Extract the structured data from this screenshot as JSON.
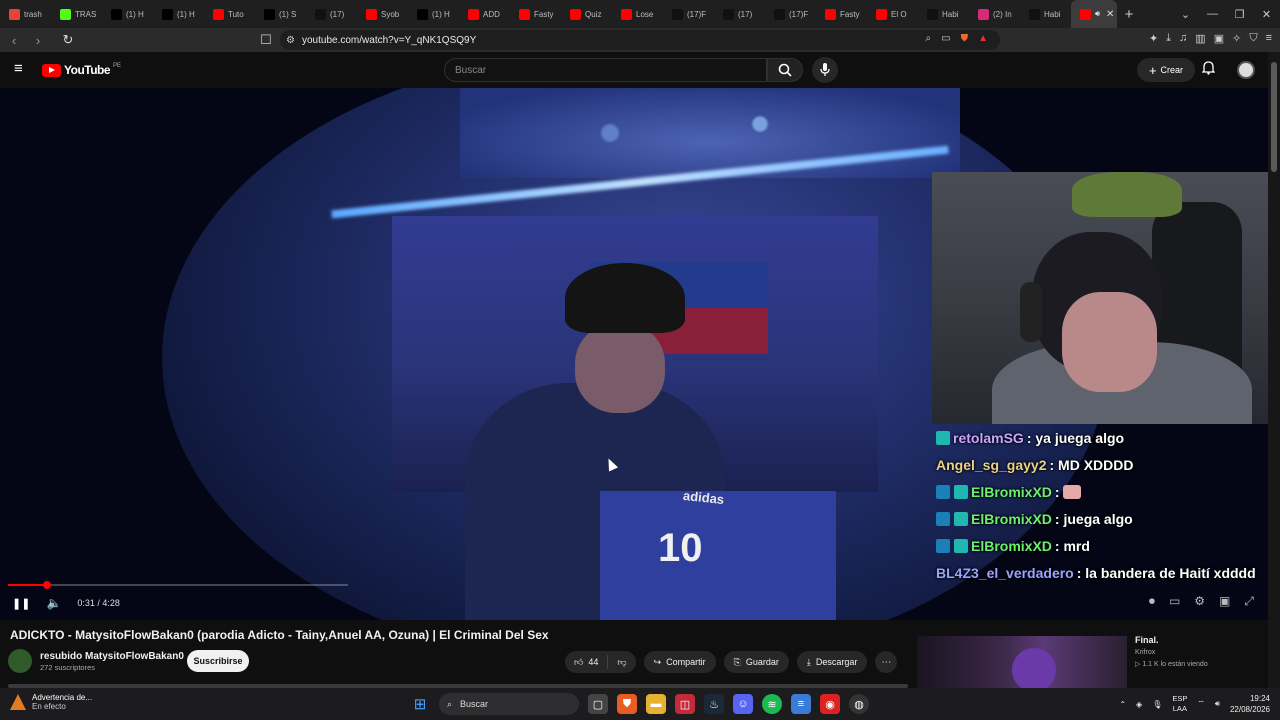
{
  "browser": {
    "tabs": [
      {
        "label": "trash",
        "icon": "gmail-icon",
        "color": "#ea4335"
      },
      {
        "label": "TRAS",
        "icon": "kick-icon",
        "color": "#53fc18"
      },
      {
        "label": "(1) H",
        "icon": "x-icon",
        "color": "#000000"
      },
      {
        "label": "(1) H",
        "icon": "x-icon",
        "color": "#000000"
      },
      {
        "label": "Tuto",
        "icon": "youtube-icon",
        "color": "#ff0000"
      },
      {
        "label": "(1) S",
        "icon": "x-icon",
        "color": "#000000"
      },
      {
        "label": "(17)",
        "icon": "tiktok-icon",
        "color": "#111111"
      },
      {
        "label": "Syob",
        "icon": "youtube-icon",
        "color": "#ff0000"
      },
      {
        "label": "(1) H",
        "icon": "x-icon",
        "color": "#000000"
      },
      {
        "label": "ADD",
        "icon": "youtube-icon",
        "color": "#ff0000"
      },
      {
        "label": "Fasty",
        "icon": "youtube-icon",
        "color": "#ff0000"
      },
      {
        "label": "Quiz",
        "icon": "youtube-icon",
        "color": "#ff0000"
      },
      {
        "label": "Lose",
        "icon": "youtube-icon",
        "color": "#ff0000"
      },
      {
        "label": "(17)F",
        "icon": "tiktok-icon",
        "color": "#111111"
      },
      {
        "label": "(17)",
        "icon": "tiktok-icon",
        "color": "#111111"
      },
      {
        "label": "(17)F",
        "icon": "tiktok-icon",
        "color": "#111111"
      },
      {
        "label": "Fasty",
        "icon": "youtube-icon",
        "color": "#ff0000"
      },
      {
        "label": "El O",
        "icon": "youtube-icon",
        "color": "#ff0000"
      },
      {
        "label": "Habi",
        "icon": "tiktok-icon",
        "color": "#111111"
      },
      {
        "label": "(2) In",
        "icon": "instagram-icon",
        "color": "#d62976"
      },
      {
        "label": "Habi",
        "icon": "tiktok-icon",
        "color": "#111111"
      }
    ],
    "url": "youtube.com/watch?v=Y_qNK1QSQ9Y"
  },
  "youtube": {
    "logo_text": "YouTube",
    "country": "PE",
    "search_placeholder": "Buscar",
    "create_label": "Crear"
  },
  "player": {
    "current_time": "0:31",
    "duration": "4:28",
    "time_display": "0:31 / 4:28",
    "progress_fraction": 0.115,
    "shirt_number": "10",
    "shirt_brand": "adidas",
    "chat": [
      {
        "user": "retolamSG",
        "message": ": ya juega algo",
        "user_color": "#c9a6ff",
        "badges": [
          "sub"
        ]
      },
      {
        "user": "Angel_sg_gayy2",
        "message": ": MD XDDDD",
        "user_color": "#e8d18a",
        "badges": []
      },
      {
        "user": "ElBromixXD",
        "message": ":",
        "user_color": "#6df06d",
        "badges": [
          "prime",
          "sub"
        ],
        "emote": true
      },
      {
        "user": "ElBromixXD",
        "message": ": juega algo",
        "user_color": "#6df06d",
        "badges": [
          "prime",
          "sub"
        ]
      },
      {
        "user": "ElBromixXD",
        "message": ": mrd",
        "user_color": "#6df06d",
        "badges": [
          "prime",
          "sub"
        ]
      },
      {
        "user": "BL4Z3_el_verdadero",
        "message": ": la bandera de Haití xdddd",
        "user_color": "#9aa3ff",
        "badges": []
      }
    ]
  },
  "video": {
    "title": "ADICKTO - MatysitoFlowBakan0 (parodia Adicto - Tainy,Anuel AA, Ozuna) | El Criminal Del Sex",
    "channel": "resubido MatysitoFlowBakan0",
    "subscribers": "272 suscriptores",
    "subscribe_label": "Suscribirse",
    "likes": "44",
    "share_label": "Compartir",
    "save_label": "Guardar",
    "download_label": "Descargar"
  },
  "recommendation": {
    "title": "Final.",
    "channel": "Krifrox",
    "live": "1.1 K lo están viendo"
  },
  "taskbar": {
    "weather_title": "Advertencia de...",
    "weather_sub": "En efecto",
    "search_label": "Buscar",
    "lang_top": "ESP",
    "lang_bottom": "LAA",
    "time": "19:24",
    "date": "22/08/2026"
  }
}
